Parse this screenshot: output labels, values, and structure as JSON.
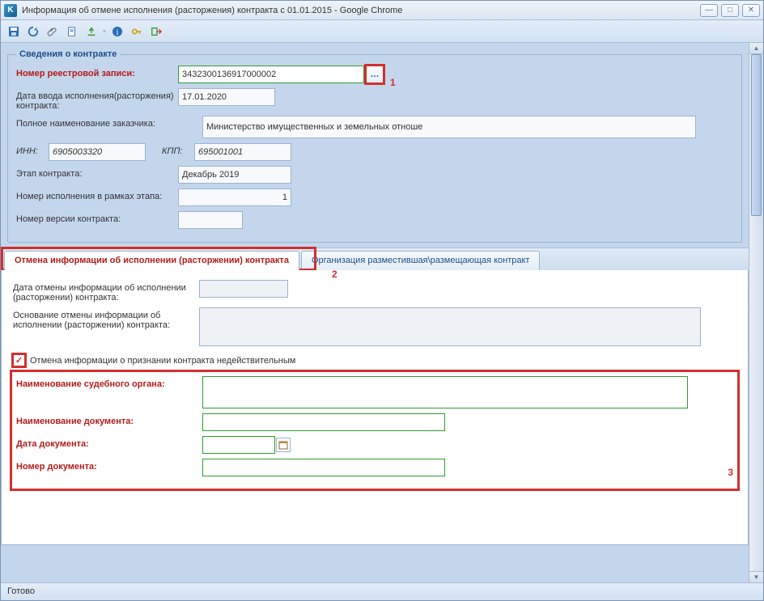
{
  "window": {
    "title": "Информация об отмене исполнения (расторжения) контракта с 01.01.2015 - Google Chrome",
    "app_icon_letter": "K"
  },
  "callouts": {
    "one": "1",
    "two": "2",
    "three": "3"
  },
  "section1": {
    "legend": "Сведения о контракте",
    "reg_label": "Номер реестровой записи:",
    "reg_value": "3432300136917000002",
    "date_in_label": "Дата ввода исполнения(расторжения) контракта:",
    "date_in_value": "17.01.2020",
    "customer_label": "Полное наименование заказчика:",
    "customer_value": "Министерство имущественных и земельных отноше",
    "inn_label": "ИНН:",
    "inn_value": "6905003320",
    "kpp_label": "КПП:",
    "kpp_value": "695001001",
    "stage_label": "Этап контракта:",
    "stage_value": "Декабрь 2019",
    "exec_num_label": "Номер исполнения в рамках этапа:",
    "exec_num_value": "1",
    "ver_label": "Номер версии контракта:",
    "ver_value": ""
  },
  "tabs": {
    "active": "Отмена информации об исполнении (расторжении) контракта",
    "other": "Организация разместившая\\размещающая контракт"
  },
  "tabbody": {
    "cancel_date_label": "Дата отмены информации об исполнении (расторжении) контракта:",
    "cancel_date_value": "",
    "cancel_reason_label": "Основание отмены информации об исполнении (расторжении) контракта:",
    "cancel_reason_value": "",
    "checkbox_label": "Отмена информации о признании контракта недействительным",
    "checkbox_checked": true,
    "court_name_label": "Наименование судебного органа:",
    "court_name_value": "",
    "doc_name_label": "Наименование документа:",
    "doc_name_value": "",
    "doc_date_label": "Дата документа:",
    "doc_date_value": "",
    "doc_num_label": "Номер документа:",
    "doc_num_value": ""
  },
  "status": "Готово"
}
